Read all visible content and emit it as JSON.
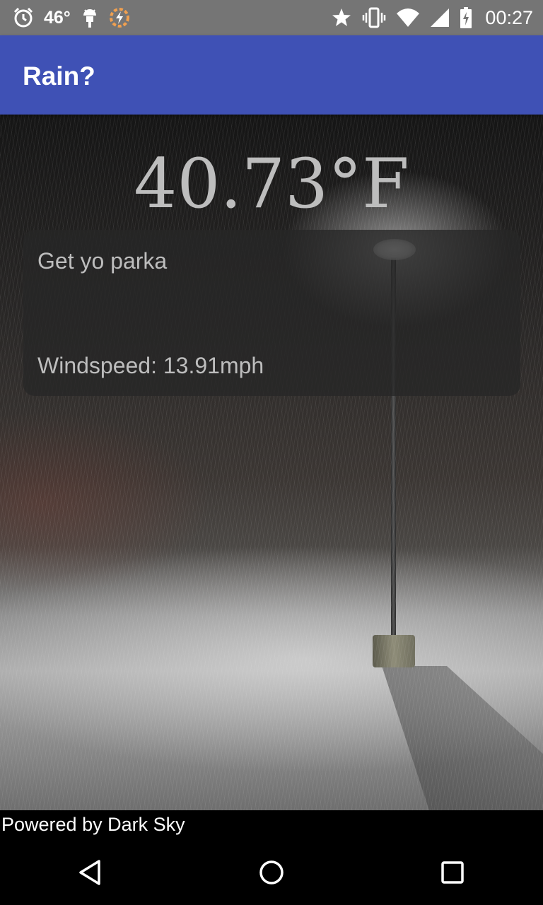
{
  "status_bar": {
    "temperature": "46°",
    "time": "00:27",
    "icons": [
      "alarm-icon",
      "android-icon",
      "tasker-icon",
      "star-icon",
      "vibrate-icon",
      "wifi-icon",
      "signal-icon",
      "battery-charging-icon"
    ]
  },
  "app_bar": {
    "title": "Rain?",
    "color": "#3f51b5"
  },
  "weather": {
    "temperature": "40.73°F",
    "summary": "Get yo parka",
    "windspeed": "Windspeed: 13.91mph"
  },
  "footer": {
    "attribution": "Powered by Dark Sky"
  },
  "nav_bar": {
    "icons": [
      "back-icon",
      "home-icon",
      "recents-icon"
    ]
  }
}
